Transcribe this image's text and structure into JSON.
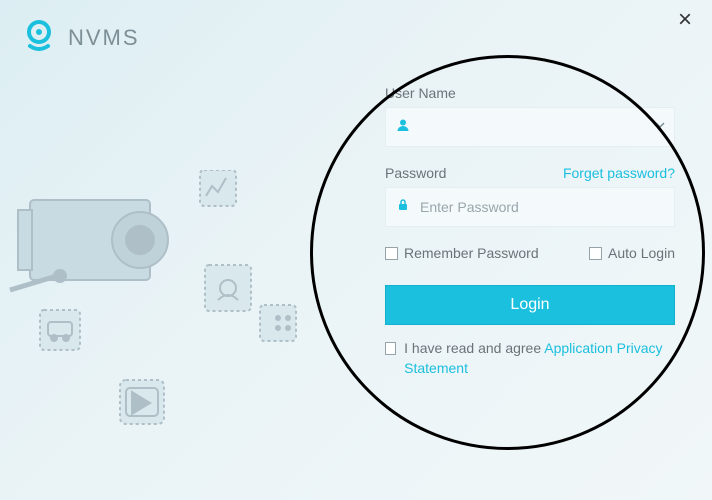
{
  "brand": {
    "title": "NVMS"
  },
  "controls": {
    "close": "×"
  },
  "form": {
    "username_label": "User Name",
    "username_value": "",
    "password_label": "Password",
    "forget_link": "Forget password?",
    "password_placeholder": "Enter Password",
    "remember_label": "Remember Password",
    "autologin_label": "Auto Login",
    "login_label": "Login",
    "agree_prefix": "I have read and agree ",
    "agree_link": "Application Privacy Statement"
  },
  "colors": {
    "accent": "#1bc0de"
  }
}
